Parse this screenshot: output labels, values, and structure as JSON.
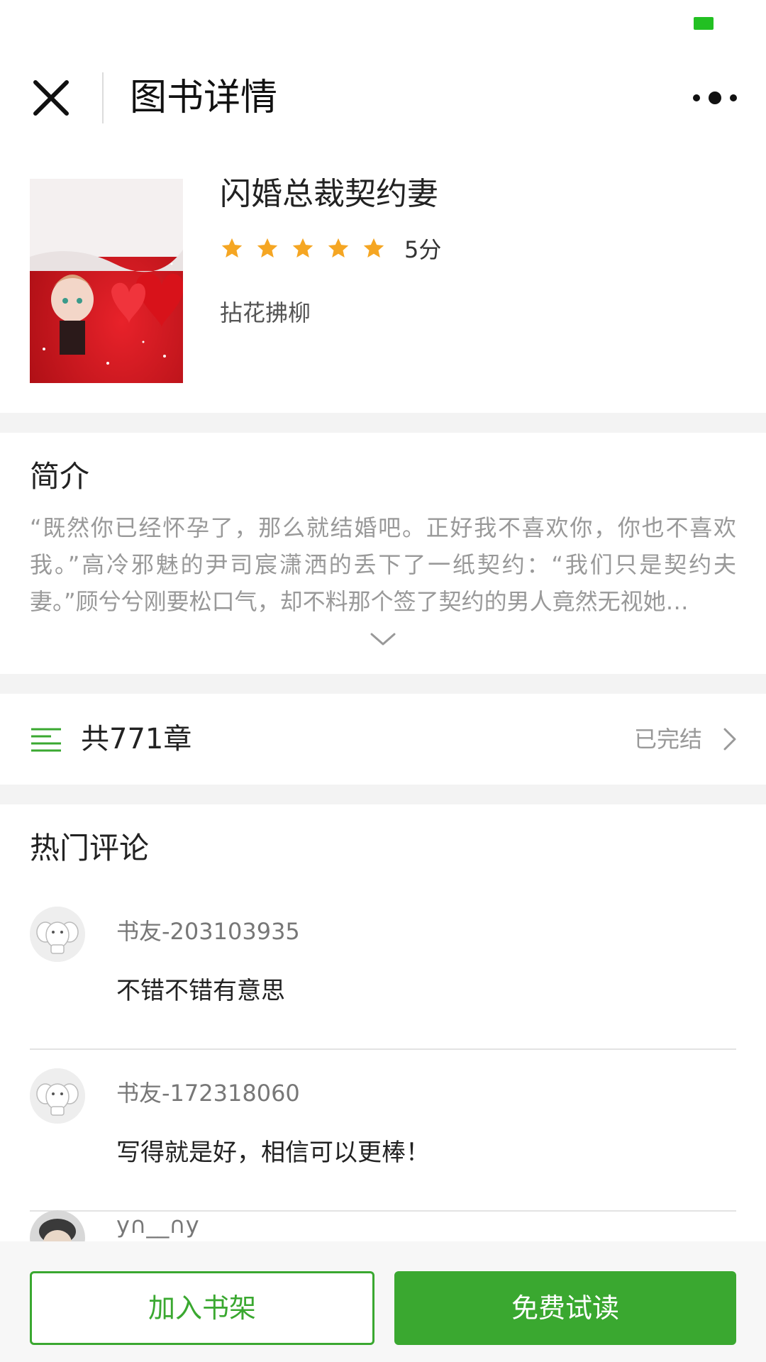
{
  "header": {
    "title": "图书详情",
    "close_icon": "close-icon",
    "more_icon": "more-icon"
  },
  "book": {
    "title": "闪婚总裁契约妻",
    "rating": 5,
    "rating_max": 5,
    "rating_text": "5分",
    "author": "拈花拂柳",
    "cover_icon": "book-cover-image"
  },
  "intro": {
    "title": "简介",
    "text": "“既然你已经怀孕了，那么就结婚吧。正好我不喜欢你，你也不喜欢我。”高冷邪魅的尹司宸潇洒的丢下了一纸契约：“我们只是契约夫妻。”顾兮兮刚要松口气，却不料那个签了契约的男人竟然无视她…",
    "expand_icon": "chevron-down-icon"
  },
  "chapters": {
    "count_text": "共771章",
    "status": "已完结",
    "list_icon": "list-icon",
    "arrow_icon": "chevron-right-icon"
  },
  "comments": {
    "title": "热门评论",
    "items": [
      {
        "user": "书友-203103935",
        "text": "不错不错有意思",
        "avatar_icon": "elephant-avatar"
      },
      {
        "user": "书友-172318060",
        "text": "写得就是好，相信可以更棒！",
        "avatar_icon": "elephant-avatar"
      },
      {
        "user": "y∩__∩y",
        "text": "",
        "avatar_icon": "user-avatar"
      }
    ]
  },
  "actions": {
    "add_shelf": "加入书架",
    "free_read": "免费试读"
  },
  "colors": {
    "accent": "#3aa830",
    "star": "#f5a623",
    "battery": "#22c022",
    "muted_text": "#999999",
    "section_gap": "#f3f3f3"
  }
}
